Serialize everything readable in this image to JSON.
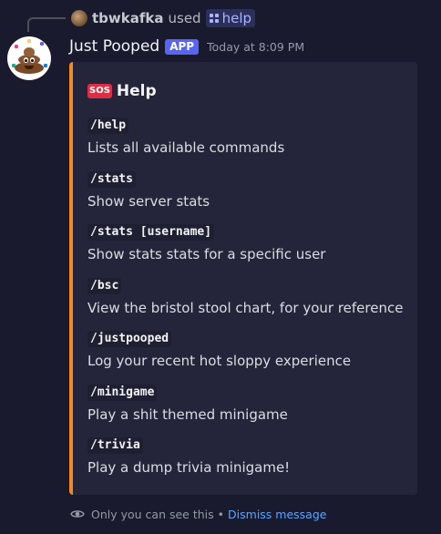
{
  "reply": {
    "username": "tbwkafka",
    "used_text": "used",
    "command": "help"
  },
  "message": {
    "bot_name": "Just Pooped",
    "app_tag": "APP",
    "timestamp": "Today at 8:09 PM"
  },
  "embed": {
    "accent_color": "#f28a24",
    "title_icon": "SOS",
    "title": "Help",
    "fields": [
      {
        "name": "/help",
        "value": "Lists all available commands"
      },
      {
        "name": "/stats",
        "value": "Show server stats"
      },
      {
        "name": "/stats [username]",
        "value": "Show stats stats for a specific user"
      },
      {
        "name": "/bsc",
        "value": "View the bristol stool chart, for your reference"
      },
      {
        "name": "/justpooped",
        "value": "Log your recent hot sloppy experience"
      },
      {
        "name": "/minigame",
        "value": "Play a shit themed minigame"
      },
      {
        "name": "/trivia",
        "value": "Play a dump trivia minigame!"
      }
    ]
  },
  "footer": {
    "visibility_text": "Only you can see this",
    "separator": "•",
    "dismiss_label": "Dismiss message"
  },
  "icons": {
    "visibility": "eye-icon",
    "command": "slash-command-icon",
    "title": "sos-icon"
  },
  "colors": {
    "background": "#191a2d",
    "embed_background": "#24253a",
    "app_tag": "#5865f2",
    "link": "#5aa6ff"
  }
}
